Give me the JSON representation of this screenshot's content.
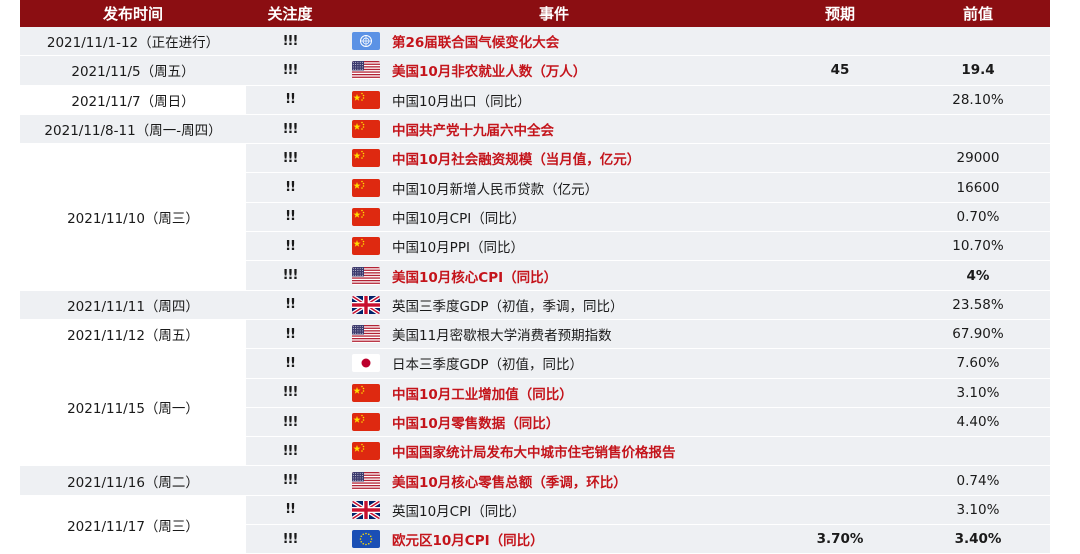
{
  "header": {
    "date": "发布时间",
    "attention": "关注度",
    "event": "事件",
    "forecast": "预期",
    "previous": "前值"
  },
  "rows": [
    {
      "date": "2021/11/1-12（正在进行）",
      "attn": "!!!",
      "flag": "un-flag-icon",
      "event": "第26届联合国气候变化大会",
      "hl": true,
      "forecast": "",
      "previous": ""
    },
    {
      "date": "2021/11/5（周五）",
      "attn": "!!!",
      "flag": "us-flag-icon",
      "event": "美国10月非农就业人数（万人）",
      "hl": true,
      "forecast": "45",
      "previous": "19.4"
    },
    {
      "date": "2021/11/7（周日）",
      "attn": "!!",
      "flag": "cn-flag-icon",
      "event": "中国10月出口（同比）",
      "hl": false,
      "forecast": "",
      "previous": "28.10%"
    },
    {
      "date": "2021/11/8-11（周一-周四）",
      "attn": "!!!",
      "flag": "cn-flag-icon",
      "event": "中国共产党十九届六中全会",
      "hl": true,
      "forecast": "",
      "previous": ""
    },
    {
      "date": "",
      "attn": "!!!",
      "flag": "cn-flag-icon",
      "event": "中国10月社会融资规模（当月值，亿元）",
      "hl": true,
      "forecast": "",
      "previous": "29000"
    },
    {
      "date": "",
      "attn": "!!",
      "flag": "cn-flag-icon",
      "event": "中国10月新增人民币贷款（亿元）",
      "hl": false,
      "forecast": "",
      "previous": "16600"
    },
    {
      "date": "2021/11/10（周三）",
      "attn": "!!",
      "flag": "cn-flag-icon",
      "event": "中国10月CPI（同比）",
      "hl": false,
      "forecast": "",
      "previous": "0.70%"
    },
    {
      "date": "",
      "attn": "!!",
      "flag": "cn-flag-icon",
      "event": "中国10月PPI（同比）",
      "hl": false,
      "forecast": "",
      "previous": "10.70%"
    },
    {
      "date": "",
      "attn": "!!!",
      "flag": "us-flag-icon",
      "event": "美国10月核心CPI（同比）",
      "hl": true,
      "forecast": "",
      "previous": "4%"
    },
    {
      "date": "2021/11/11（周四）",
      "attn": "!!",
      "flag": "uk-flag-icon",
      "event": "英国三季度GDP（初值，季调，同比）",
      "hl": false,
      "forecast": "",
      "previous": "23.58%"
    },
    {
      "date": "2021/11/12（周五）",
      "attn": "!!",
      "flag": "us-flag-icon",
      "event": "美国11月密歇根大学消费者预期指数",
      "hl": false,
      "forecast": "",
      "previous": "67.90%"
    },
    {
      "date": "",
      "attn": "!!",
      "flag": "jp-flag-icon",
      "event": "日本三季度GDP（初值，同比）",
      "hl": false,
      "forecast": "",
      "previous": "7.60%"
    },
    {
      "date": "2021/11/15（周一）",
      "attn": "!!!",
      "flag": "cn-flag-icon",
      "event": "中国10月工业增加值（同比）",
      "hl": true,
      "forecast": "",
      "previous": "3.10%"
    },
    {
      "date": "",
      "attn": "!!!",
      "flag": "cn-flag-icon",
      "event": "中国10月零售数据（同比）",
      "hl": true,
      "forecast": "",
      "previous": "4.40%"
    },
    {
      "date": "",
      "attn": "!!!",
      "flag": "cn-flag-icon",
      "event": "中国国家统计局发布大中城市住宅销售价格报告",
      "hl": true,
      "forecast": "",
      "previous": ""
    },
    {
      "date": "2021/11/16（周二）",
      "attn": "!!!",
      "flag": "us-flag-icon",
      "event": "美国10月核心零售总额（季调，环比）",
      "hl": true,
      "forecast": "",
      "previous": "0.74%"
    },
    {
      "date": "2021/11/17（周三）",
      "attn": "!!",
      "flag": "uk-flag-icon",
      "event": "英国10月CPI（同比）",
      "hl": false,
      "forecast": "",
      "previous": "3.10%"
    },
    {
      "date": "",
      "attn": "!!!",
      "flag": "eu-flag-icon",
      "event": "欧元区10月CPI（同比）",
      "hl": true,
      "forecast": "3.70%",
      "previous": "3.40%"
    }
  ],
  "colors": {
    "header_bg": "#8b0e12",
    "highlight_text": "#c4141b",
    "stripe": "#eef0f3"
  }
}
